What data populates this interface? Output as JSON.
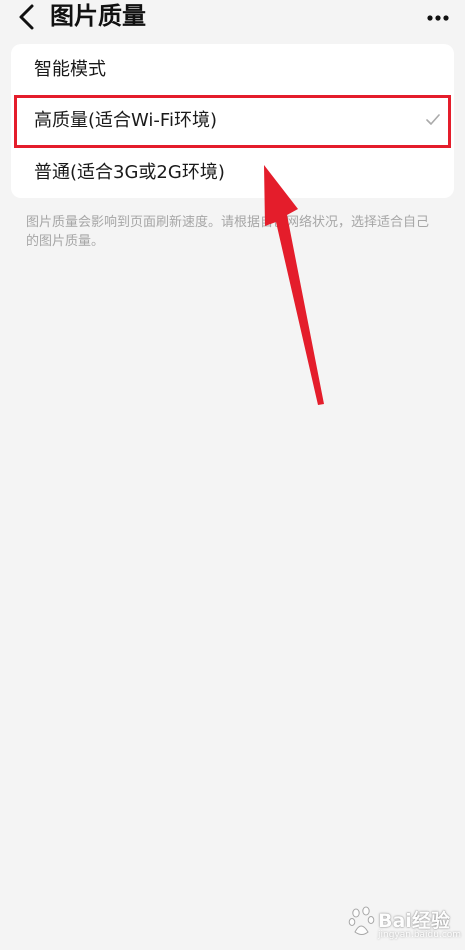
{
  "header": {
    "title": "图片质量",
    "back_icon": "chevron-left-icon",
    "more_icon": "more-horizontal-icon"
  },
  "options": [
    {
      "label": "智能模式",
      "selected": false
    },
    {
      "label": "高质量(适合Wi-Fi环境)",
      "selected": true
    },
    {
      "label": "普通(适合3G或2G环境)",
      "selected": false
    }
  ],
  "description": "图片质量会影响到页面刷新速度。请根据自己网络状况，选择适合自己的图片质量。",
  "annotation": {
    "highlight_color": "#e41d2b",
    "arrow_color": "#e41d2b"
  },
  "watermark": {
    "brand": "Bai经验",
    "sub": "jingyan.baidu.com"
  }
}
